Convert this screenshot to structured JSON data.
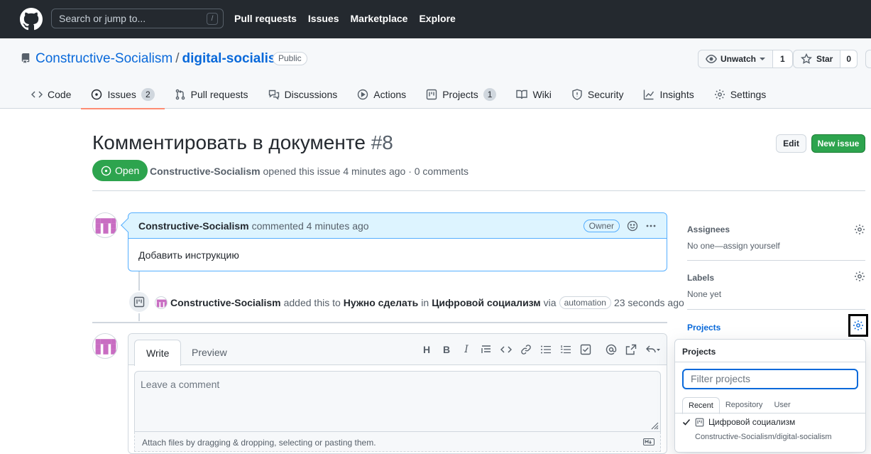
{
  "header": {
    "search_placeholder": "Search or jump to...",
    "slash_hint": "/",
    "nav": [
      "Pull requests",
      "Issues",
      "Marketplace",
      "Explore"
    ]
  },
  "repo": {
    "owner": "Constructive-Socialism",
    "separator": "/",
    "name": "digital-socialism",
    "visibility": "Public",
    "watch_label": "Unwatch",
    "watch_count": "1",
    "star_label": "Star",
    "star_count": "0"
  },
  "tabs": [
    {
      "label": "Code",
      "icon": "code-icon"
    },
    {
      "label": "Issues",
      "icon": "issue-icon",
      "counter": "2",
      "selected": true
    },
    {
      "label": "Pull requests",
      "icon": "pull-request-icon"
    },
    {
      "label": "Discussions",
      "icon": "discussion-icon"
    },
    {
      "label": "Actions",
      "icon": "play-icon"
    },
    {
      "label": "Projects",
      "icon": "project-icon",
      "counter": "1"
    },
    {
      "label": "Wiki",
      "icon": "book-icon"
    },
    {
      "label": "Security",
      "icon": "shield-icon"
    },
    {
      "label": "Insights",
      "icon": "graph-icon"
    },
    {
      "label": "Settings",
      "icon": "gear-icon"
    }
  ],
  "issue": {
    "title": "Комментировать в документе",
    "number": "#8",
    "edit_label": "Edit",
    "new_label": "New issue",
    "state": "Open",
    "author": "Constructive-Socialism",
    "meta_rest": "opened this issue 4 minutes ago · 0 comments"
  },
  "comment": {
    "author": "Constructive-Socialism",
    "action": "commented 4 minutes ago",
    "badge": "Owner",
    "body": "Добавить инструкцию"
  },
  "event": {
    "actor": "Constructive-Socialism",
    "text1": "added this to",
    "column": "Нужно сделать",
    "text2": "in",
    "project": "Цифровой социализм",
    "text3": "via",
    "via": "automation",
    "time": "23 seconds ago"
  },
  "composer": {
    "write_tab": "Write",
    "preview_tab": "Preview",
    "placeholder": "Leave a comment",
    "attach_text": "Attach files by dragging & dropping, selecting or pasting them."
  },
  "sidebar": {
    "assignees_label": "Assignees",
    "assignees_value": "No one—assign yourself",
    "labels_label": "Labels",
    "labels_value": "None yet",
    "projects_label": "Projects"
  },
  "popover": {
    "title": "Projects",
    "filter_placeholder": "Filter projects",
    "tabs": [
      "Recent",
      "Repository",
      "User"
    ],
    "item_name": "Цифровой социализм",
    "item_sub": "Constructive-Socialism/digital-socialism"
  },
  "colors": {
    "header_bg": "#24292f",
    "link": "#0969da",
    "open_green": "#2da44e",
    "comment_header": "#ddf4ff",
    "tab_underline": "#fd8c73"
  }
}
